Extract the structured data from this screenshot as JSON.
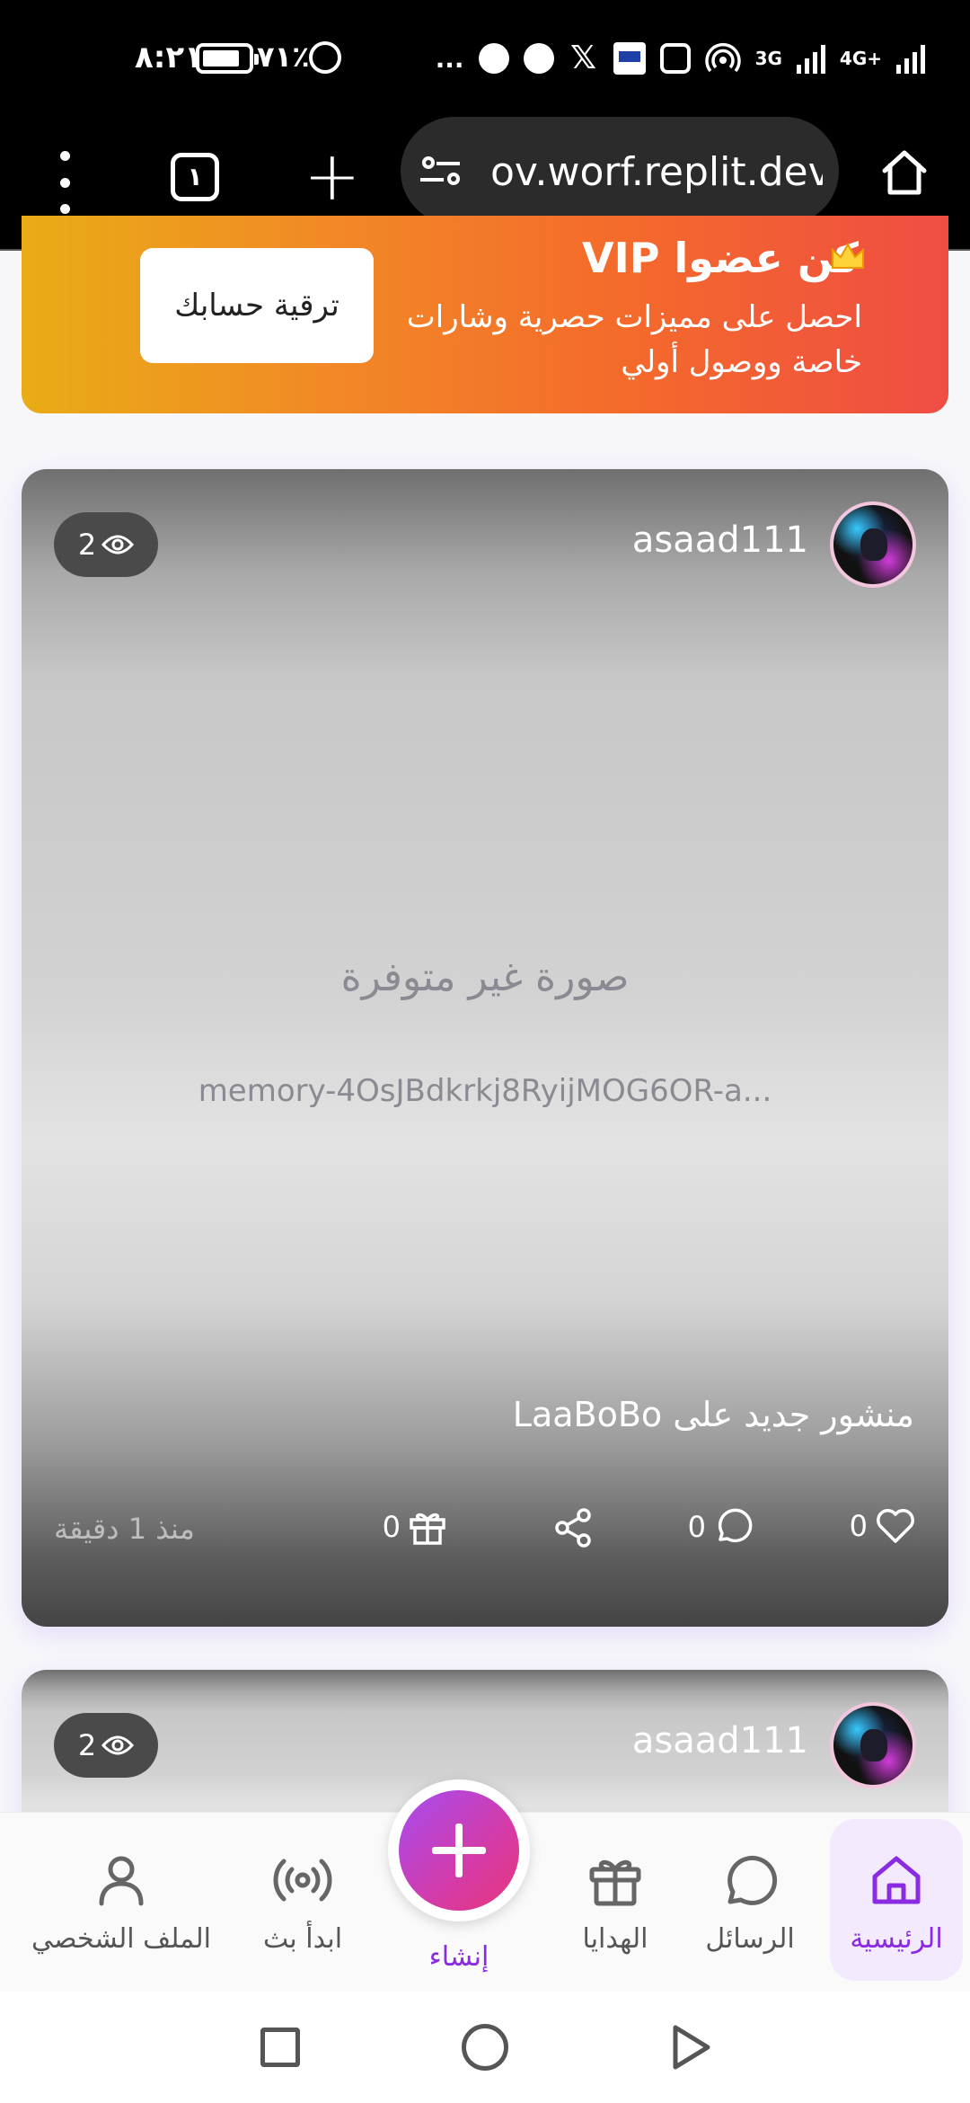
{
  "status_bar": {
    "time": "٨:٢١",
    "battery_percent": "٧١٪",
    "more_indicator": "...",
    "network_labels": [
      "3G",
      "4G+"
    ],
    "icons": [
      "alarm-icon",
      "battery-icon",
      "notification-icon",
      "facebook-icon",
      "x-icon",
      "news-app-icon",
      "instagram-icon",
      "hotspot-icon",
      "signal-icon"
    ]
  },
  "browser": {
    "url": "ov.worf.replit.dev",
    "tab_count": "١",
    "icons": [
      "menu-icon",
      "tabs-icon",
      "new-tab-icon",
      "site-settings-icon",
      "home-icon"
    ]
  },
  "vip_banner": {
    "title": "كن عضوا VIP",
    "description": "احصل على مميزات حصرية وشارات خاصة ووصول أولي",
    "button_label": "ترقية حسابك",
    "colors": {
      "start": "#e9ac16",
      "end": "#ef4d43"
    }
  },
  "posts": [
    {
      "username": "asaad111",
      "views": "2",
      "image_unavailable": "صورة غير متوفرة",
      "filename": "memory-4OsJBdkrkj8RyijMOG6OR-a...",
      "caption": "منشور جديد على LaaBoBo",
      "likes": "0",
      "comments": "0",
      "gifts": "0",
      "time_ago": "منذ 1 دقيقة"
    },
    {
      "username": "asaad111",
      "views": "2"
    }
  ],
  "bottom_nav": {
    "home": "الرئيسية",
    "messages": "الرسائل",
    "gifts": "الهدايا",
    "create": "إنشاء",
    "live": "ابدأ بث",
    "profile": "الملف الشخصي",
    "active": "home",
    "accent": "#8a2be2"
  }
}
